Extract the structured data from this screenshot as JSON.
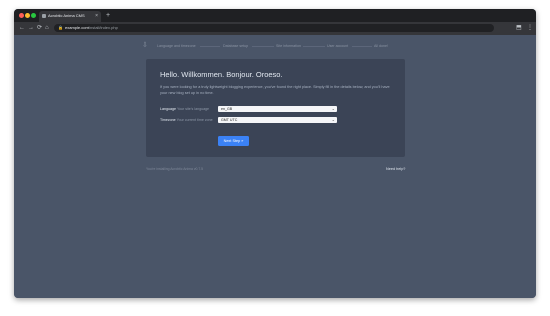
{
  "browser": {
    "tab_title": "Acrobtic Anima CMS",
    "tab_close": "×",
    "new_tab": "+",
    "back": "←",
    "forward": "→",
    "reload": "⟳",
    "home": "⌂",
    "lock": "🔒",
    "url_host": "example.com",
    "url_path": "/install/index.php",
    "extensions_icon": "⬒",
    "menu_icon": "⋮"
  },
  "steps": {
    "icon": "⇩",
    "items": [
      "Language and timezone",
      "Database setup",
      "Site information",
      "User account",
      "All done!"
    ]
  },
  "card": {
    "title": "Hello. Willkommen. Bonjour. Oroeso.",
    "intro": "If you were looking for a truly lightweight blogging experience, you've found the right place. Simply fill in the details below, and you'll have your new blog set up in no time.",
    "language_label": "Language",
    "language_hint": "Your site's language",
    "language_value": "en_GB",
    "timezone_label": "Timezone",
    "timezone_hint": "Your current time zone",
    "timezone_value": "GMT UTC",
    "chevron": "⌄",
    "next_button": "Next Step »"
  },
  "footer": {
    "left": "You're installing Acrobtic Anima v0.7.5",
    "right": "Need help?"
  }
}
